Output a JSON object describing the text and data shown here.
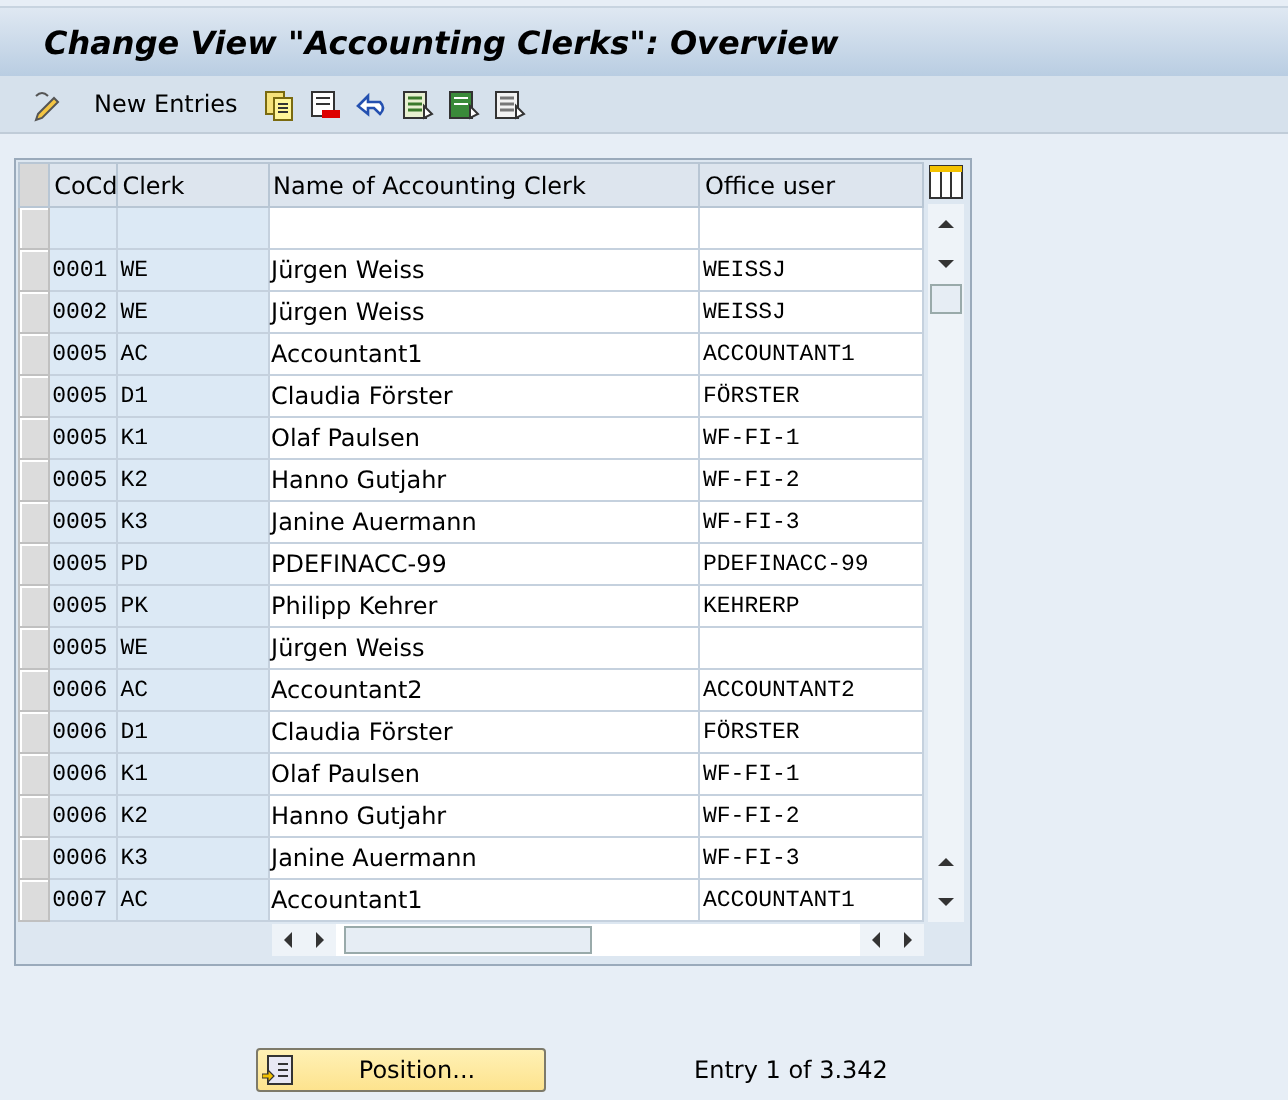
{
  "window": {
    "title": "Change View \"Accounting Clerks\": Overview"
  },
  "toolbar": {
    "items": [
      {
        "kind": "icon"
      },
      {
        "kind": "text",
        "label": "New Entries"
      },
      {
        "kind": "icon"
      },
      {
        "kind": "icon"
      },
      {
        "kind": "icon"
      },
      {
        "kind": "icon"
      },
      {
        "kind": "icon"
      },
      {
        "kind": "icon"
      }
    ]
  },
  "table": {
    "columns": [
      "CoCd",
      "Clerk",
      "Name of Accounting Clerk",
      "Office user"
    ],
    "rows": [
      {
        "cocd": "0001",
        "clerk": "WE",
        "name": "Jürgen Weiss",
        "office_user": "WEISSJ"
      },
      {
        "cocd": "0002",
        "clerk": "WE",
        "name": "Jürgen Weiss",
        "office_user": "WEISSJ"
      },
      {
        "cocd": "0005",
        "clerk": "AC",
        "name": "Accountant1",
        "office_user": "ACCOUNTANT1"
      },
      {
        "cocd": "0005",
        "clerk": "D1",
        "name": "Claudia Förster",
        "office_user": "FÖRSTER"
      },
      {
        "cocd": "0005",
        "clerk": "K1",
        "name": "Olaf Paulsen",
        "office_user": "WF-FI-1"
      },
      {
        "cocd": "0005",
        "clerk": "K2",
        "name": "Hanno Gutjahr",
        "office_user": "WF-FI-2"
      },
      {
        "cocd": "0005",
        "clerk": "K3",
        "name": "Janine Auermann",
        "office_user": "WF-FI-3"
      },
      {
        "cocd": "0005",
        "clerk": "PD",
        "name": "PDEFINACC-99",
        "office_user": "PDEFINACC-99"
      },
      {
        "cocd": "0005",
        "clerk": "PK",
        "name": "Philipp Kehrer",
        "office_user": "KEHRERP"
      },
      {
        "cocd": "0005",
        "clerk": "WE",
        "name": "Jürgen Weiss"
      },
      {
        "cocd": "0006",
        "clerk": "AC",
        "name": "Accountant2",
        "office_user": "ACCOUNTANT2"
      },
      {
        "cocd": "0006",
        "clerk": "D1",
        "name": "Claudia Förster",
        "office_user": "FÖRSTER"
      },
      {
        "cocd": "0006",
        "clerk": "K1",
        "name": "Olaf Paulsen",
        "office_user": "WF-FI-1"
      },
      {
        "cocd": "0006",
        "clerk": "K2",
        "name": "Hanno Gutjahr",
        "office_user": "WF-FI-2"
      },
      {
        "cocd": "0006",
        "clerk": "K3",
        "name": "Janine Auermann",
        "office_user": "WF-FI-3"
      },
      {
        "cocd": "0007",
        "clerk": "AC",
        "name": "Accountant1",
        "office_user": "ACCOUNTANT1"
      }
    ]
  },
  "footer": {
    "position_button": "Position...",
    "entry_info": "Entry 1 of 3.342"
  }
}
